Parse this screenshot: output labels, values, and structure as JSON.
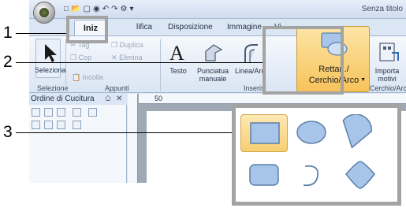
{
  "window": {
    "title": "Senza titolo"
  },
  "tabs": {
    "home": "Iniz",
    "modify": "lifica",
    "layout": "Disposizione",
    "image": "Immagine",
    "view": "Vi"
  },
  "ribbon": {
    "select": {
      "label_line1": "Seleziona",
      "label_line2": ""
    },
    "clipboard": {
      "cut": "Tag",
      "copy": "Cop",
      "duplicate": "Duplica",
      "delete": "Elimina",
      "paste": "Incolla",
      "group_label": "Appunti"
    },
    "select_group_label": "Selezione",
    "text": "Testo",
    "manual_punch_line1": "Punciatua",
    "manual_punch_line2": "manuale",
    "line_arc": "Linea/Arc",
    "insert_group_label": "Inseris",
    "import_motifs_line1": "Importa",
    "import_motifs_line2": "motivi",
    "shape_button_line1": "Rettan./",
    "shape_button_line2": "Cerchio/Arco",
    "shape_group_label": "Cerchio/Arc"
  },
  "panel": {
    "title": "Ordine di Cucitura",
    "pin": "⎐",
    "close": "✕"
  },
  "ruler": {
    "mark": "50"
  },
  "gallery": {
    "items": [
      {
        "name": "rectangle",
        "selected": true
      },
      {
        "name": "ellipse",
        "selected": false
      },
      {
        "name": "fan",
        "selected": false
      },
      {
        "name": "rounded-rectangle",
        "selected": false
      },
      {
        "name": "arc",
        "selected": false
      },
      {
        "name": "diamond",
        "selected": false
      }
    ]
  },
  "callouts": {
    "one": "1",
    "two": "2",
    "three": "3"
  },
  "colors": {
    "shape_fill": "#a7c5e8",
    "shape_stroke": "#5b7fa8",
    "selected_bg": "#f8ce72"
  }
}
